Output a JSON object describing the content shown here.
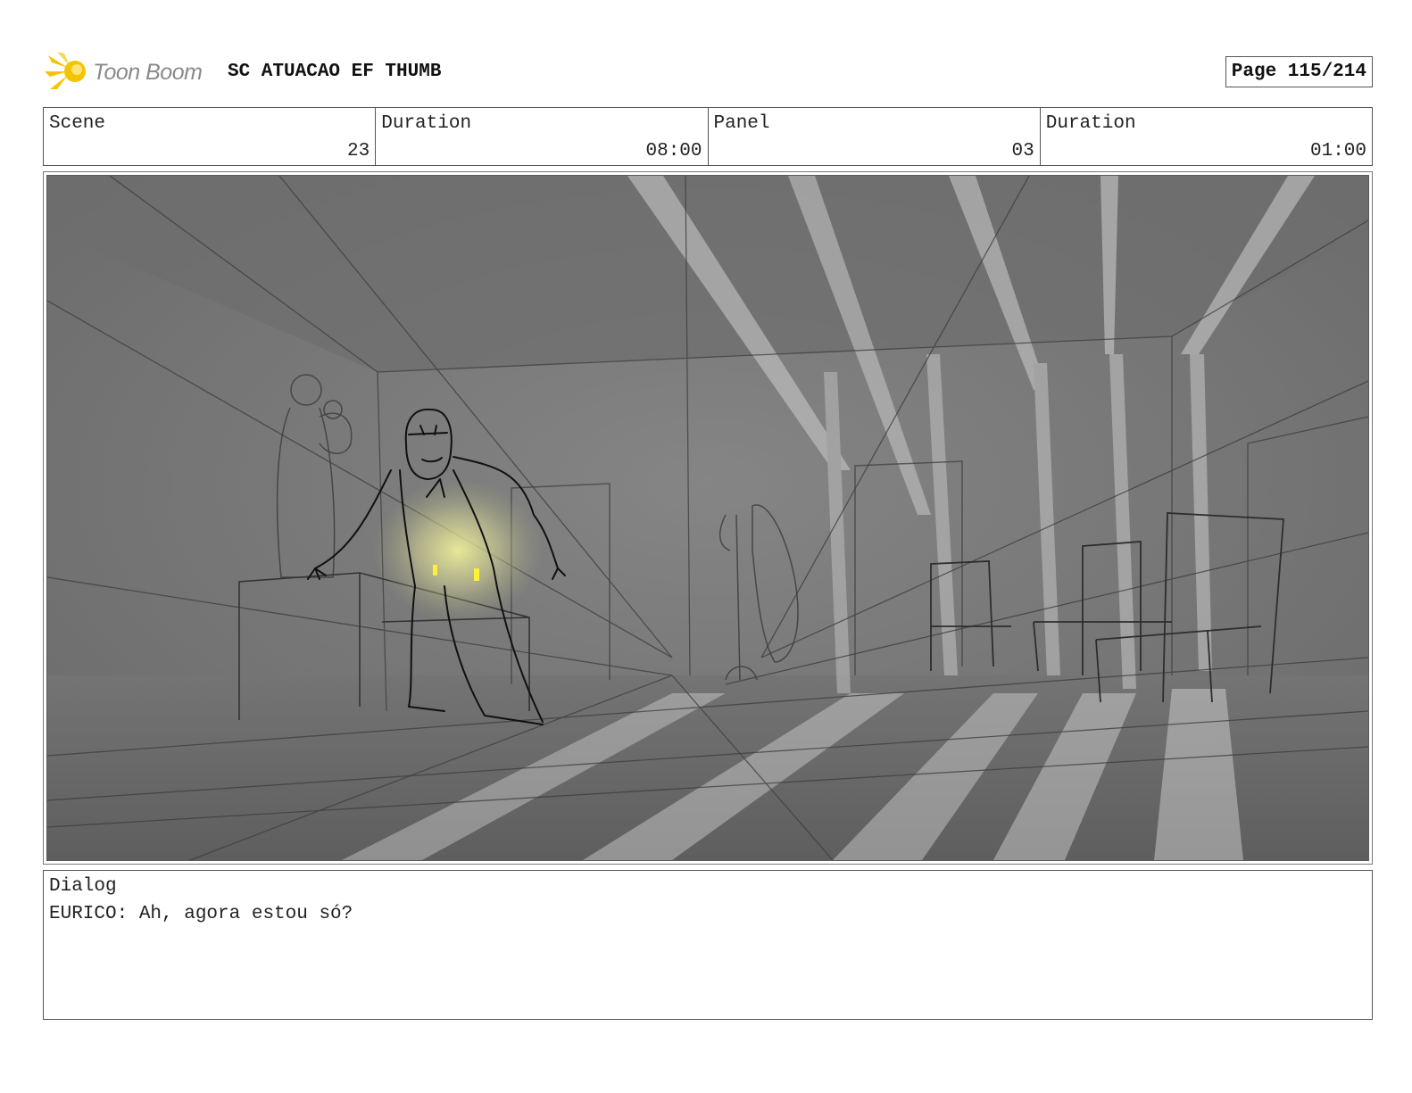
{
  "header": {
    "logo_text": "Toon Boom",
    "project_title": "SC ATUACAO EF THUMB",
    "page_label": "Page 115/214"
  },
  "info": {
    "scene_label": "Scene",
    "scene_value": "23",
    "scene_duration_label": "Duration",
    "scene_duration_value": "08:00",
    "panel_label": "Panel",
    "panel_value": "03",
    "panel_duration_label": "Duration",
    "panel_duration_value": "01:00"
  },
  "dialog": {
    "label": "Dialog",
    "text": "EURICO: Ah, agora estou só?"
  },
  "colors": {
    "logo_accent": "#f5c400",
    "sketch_bg": "#7a7a7a",
    "lantern_glow": "#f4f59a"
  },
  "icons": {
    "logo": "toon-boom-logo-icon"
  }
}
